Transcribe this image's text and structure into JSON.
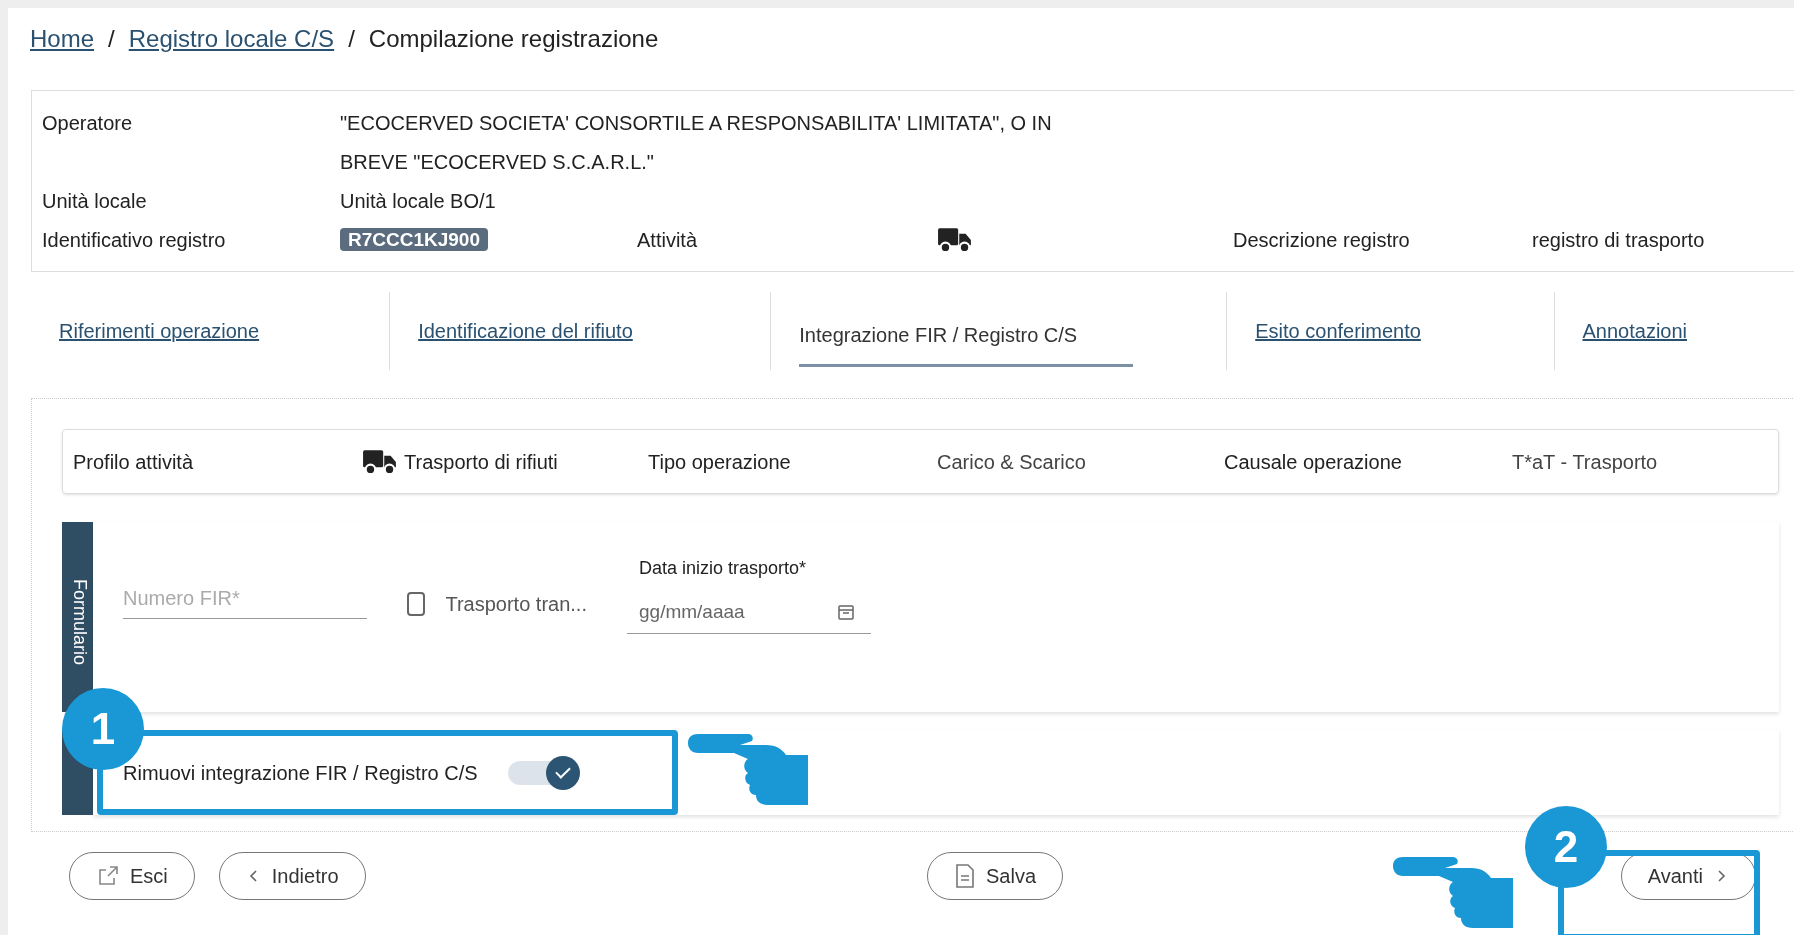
{
  "breadcrumb": [
    {
      "kind": "link",
      "label": "Home"
    },
    {
      "kind": "separator",
      "label": "/"
    },
    {
      "kind": "link",
      "label": "Registro locale C/S"
    },
    {
      "kind": "separator",
      "label": "/"
    },
    {
      "kind": "current",
      "label": "Compilazione registrazione"
    }
  ],
  "register": {
    "operator_label": "Operatore",
    "operator_lines": [
      "\"ECOCERVED SOCIETA' CONSORTILE A RESPONSABILITA' LIMITATA\", O IN",
      "BREVE \"ECOCERVED S.C.A.R.L.\""
    ],
    "unit_label": "Unità locale",
    "unit_value": "Unità locale BO/1",
    "id_label": "Identificativo registro",
    "id_badge": "R7CCC1KJ900",
    "activity_label": "Attività",
    "description_label": "Descrizione registro",
    "description_value": "registro di trasporto"
  },
  "tabs": [
    {
      "label": "Riferimenti operazione",
      "selected": false
    },
    {
      "label": "Identificazione del rifiuto",
      "selected": false
    },
    {
      "label": "Integrazione FIR / Registro C/S",
      "selected": true
    },
    {
      "label": "Esito conferimento",
      "selected": false
    },
    {
      "label": "Annotazioni",
      "selected": false
    }
  ],
  "profile": [
    {
      "kind": "label",
      "text": "Profilo attività"
    },
    {
      "kind": "truck",
      "text": "Trasporto di rifiuti"
    },
    {
      "kind": "label",
      "text": "Tipo operazione"
    },
    {
      "kind": "value",
      "text": "Carico & Scarico"
    },
    {
      "kind": "label",
      "text": "Causale operazione"
    },
    {
      "kind": "value",
      "text": "T*aT - Trasporto"
    }
  ],
  "form": {
    "side_label": "Formulario",
    "fir_placeholder": "Numero FIR*",
    "checkbox": {
      "label": "Trasporto tran...",
      "checked": false
    },
    "date_label": "Data inizio trasporto*",
    "date_placeholder": "gg/mm/aaaa"
  },
  "remove_toggle": {
    "label": "Rimuovi integrazione FIR / Registro C/S",
    "on": true
  },
  "buttons": [
    {
      "kind": "exit",
      "label": "Esci"
    },
    {
      "kind": "back",
      "label": "Indietro"
    },
    {
      "kind": "save",
      "label": "Salva"
    },
    {
      "kind": "next",
      "label": "Avanti"
    }
  ],
  "annotations": [
    {
      "number": "1"
    },
    {
      "number": "2"
    }
  ]
}
